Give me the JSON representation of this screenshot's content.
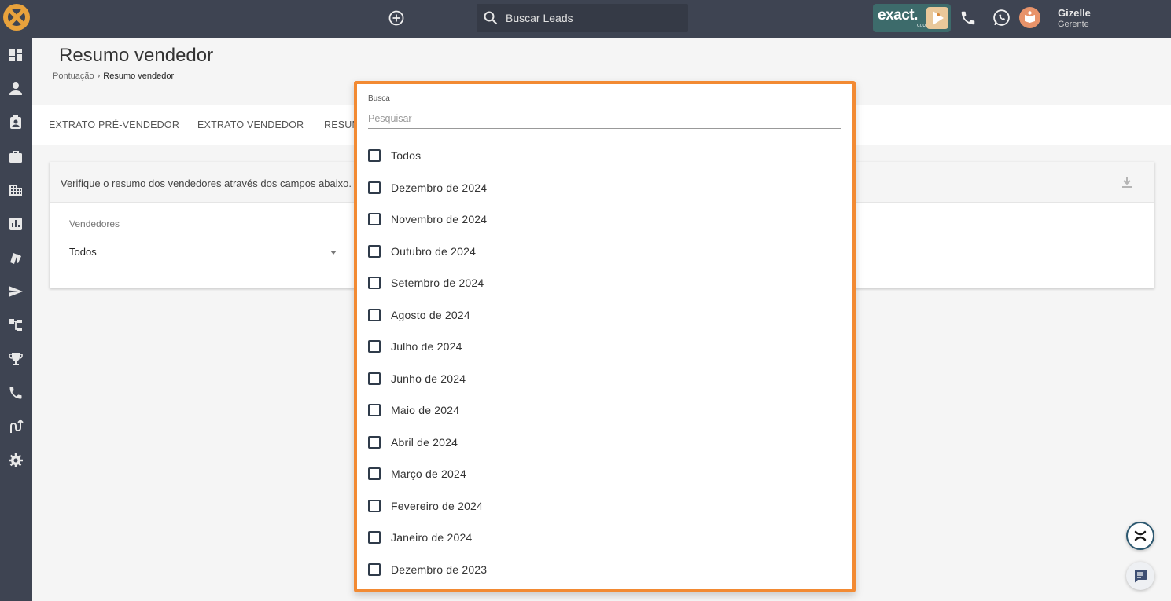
{
  "topbar": {
    "search_placeholder": "Buscar Leads",
    "brand_text": "exact.",
    "brand_sub": "CLUB",
    "user_name": "Gizelle",
    "user_role": "Gerente"
  },
  "page": {
    "title": "Resumo vendedor",
    "breadcrumb": [
      "Pontuação",
      "Resumo vendedor"
    ]
  },
  "tabs": [
    "EXTRATO PRÉ-VENDEDOR",
    "EXTRATO VENDEDOR",
    "RESUM"
  ],
  "card": {
    "header_text": "Verifique o resumo dos vendedores através dos campos abaixo. O",
    "field_label": "Vendedores",
    "field_value": "Todos"
  },
  "dropdown": {
    "search_label": "Busca",
    "search_placeholder": "Pesquisar",
    "options": [
      "Todos",
      "Dezembro de 2024",
      "Novembro de 2024",
      "Outubro de 2024",
      "Setembro de 2024",
      "Agosto de 2024",
      "Julho de 2024",
      "Junho de 2024",
      "Maio de 2024",
      "Abril de 2024",
      "Março de 2024",
      "Fevereiro de 2024",
      "Janeiro de 2024",
      "Dezembro de 2023"
    ]
  },
  "colors": {
    "topbar": "#3e4452",
    "accent_border": "#f28a33",
    "brand_badge": "#3d6b6b",
    "avatar": "#e8936a"
  }
}
